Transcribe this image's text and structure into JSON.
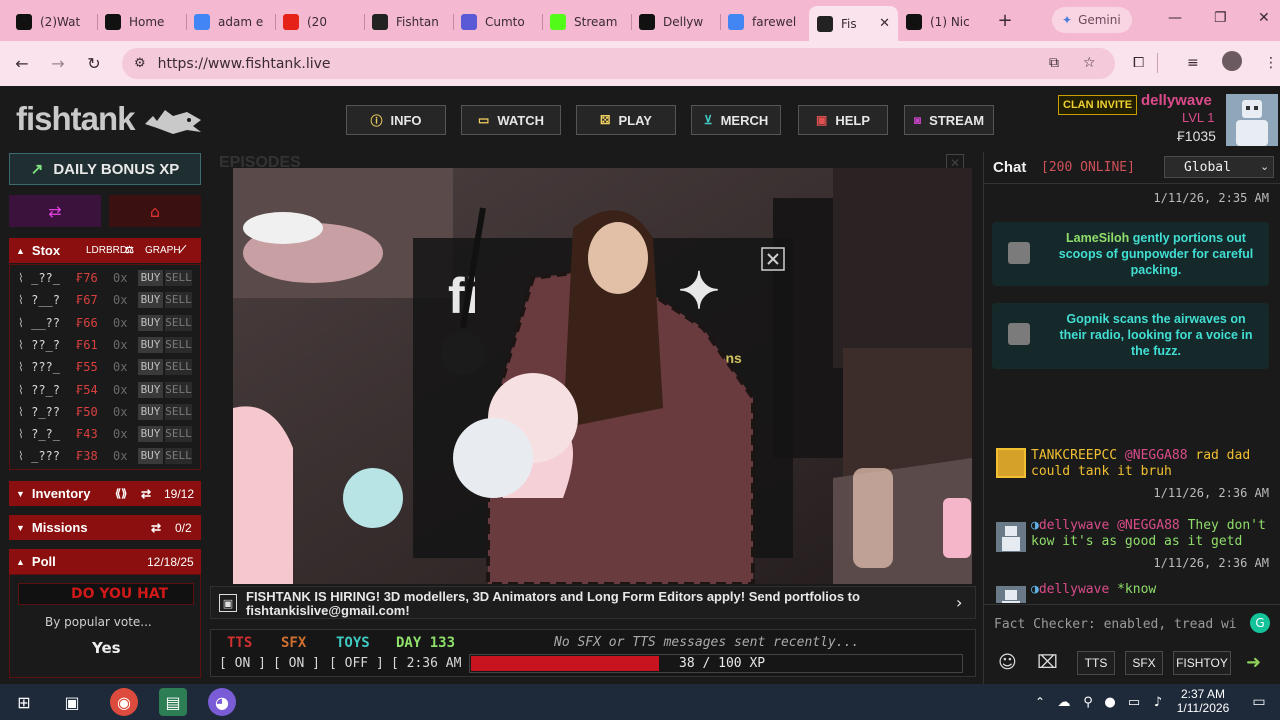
{
  "browser": {
    "tabs": [
      {
        "title": "(2)Wat",
        "icon": "tiktok-icon",
        "color": "#111111"
      },
      {
        "title": "Home",
        "icon": "x-icon",
        "color": "#111111"
      },
      {
        "title": "adam e",
        "icon": "google-icon",
        "color": "#4285f4"
      },
      {
        "title": "(20",
        "icon": "youtube-icon",
        "color": "#e62117"
      },
      {
        "title": "Fishtan",
        "icon": "fishtank-icon",
        "color": "#222222"
      },
      {
        "title": "Cumto",
        "icon": "headset-icon",
        "color": "#5a5ad6"
      },
      {
        "title": "Stream",
        "icon": "kick-icon",
        "color": "#53fc18"
      },
      {
        "title": "Dellyw",
        "icon": "tiktok-icon",
        "color": "#111111"
      },
      {
        "title": "farewel",
        "icon": "google-icon",
        "color": "#4285f4"
      },
      {
        "title": "Fis",
        "icon": "fishtank-icon",
        "color": "#222222"
      },
      {
        "title": "(1) Nic",
        "icon": "x-icon",
        "color": "#111111"
      }
    ],
    "active_tab_index": 9,
    "url": "https://www.fishtank.live",
    "gemini_label": "Gemini"
  },
  "site": {
    "logo": "fishtank",
    "nav": [
      {
        "label": "INFO",
        "icon": "info-icon",
        "color": "#f0d060"
      },
      {
        "label": "WATCH",
        "icon": "camera-icon",
        "color": "#f0d060"
      },
      {
        "label": "PLAY",
        "icon": "dice-icon",
        "color": "#f0d060"
      },
      {
        "label": "MERCH",
        "icon": "cart-icon",
        "color": "#3fc9c0"
      },
      {
        "label": "HELP",
        "icon": "help-icon",
        "color": "#e05050"
      },
      {
        "label": "STREAM",
        "icon": "stream-icon",
        "color": "#cc44cc"
      }
    ],
    "user": {
      "clan_invite": "CLAN INVITE",
      "name": "dellywave",
      "level": "LVL 1",
      "coins": "₣1035"
    }
  },
  "sidebar": {
    "daily_bonus": "DAILY BONUS XP",
    "stox": {
      "title": "Stox",
      "leaderboard": "LDRBRD",
      "graph": "GRAPH",
      "rows": [
        {
          "ticker": "_??_",
          "price": "₣76",
          "count": "0x"
        },
        {
          "ticker": "?__?",
          "price": "₣67",
          "count": "0x"
        },
        {
          "ticker": "__??",
          "price": "₣66",
          "count": "0x"
        },
        {
          "ticker": "??_?",
          "price": "₣61",
          "count": "0x"
        },
        {
          "ticker": "???_",
          "price": "₣55",
          "count": "0x"
        },
        {
          "ticker": "??_?",
          "price": "₣54",
          "count": "0x"
        },
        {
          "ticker": "?_??",
          "price": "₣50",
          "count": "0x"
        },
        {
          "ticker": "?_?_",
          "price": "₣43",
          "count": "0x"
        },
        {
          "ticker": "_???",
          "price": "₣38",
          "count": "0x"
        }
      ],
      "buy": "BUY",
      "sell": "SELL"
    },
    "inventory": {
      "title": "Inventory",
      "count": "19/12"
    },
    "missions": {
      "title": "Missions",
      "count": "0/2"
    },
    "poll": {
      "title": "Poll",
      "date": "12/18/25",
      "marquee": "DO YOU HAT",
      "by_vote": "By popular vote...",
      "answer": "Yes"
    }
  },
  "stream": {
    "episodes_label": "EPISODES",
    "hiring": "FISHTANK IS HIRING! 3D modellers, 3D Animators and Long Form Editors apply! Send portfolios to fishtankislive@gmail.com!",
    "tts": {
      "label": "TTS",
      "value": "[ ON ]"
    },
    "sfx": {
      "label": "SFX",
      "value": "[ ON ]"
    },
    "toys": {
      "label": "TOYS",
      "value": "[ OFF ]"
    },
    "day": {
      "label": "DAY 133",
      "time": "[ 2:36 AM ]"
    },
    "no_msg": "No SFX or TTS messages sent recently...",
    "xp": {
      "text": "38 / 100 XP",
      "progress": 0.38
    }
  },
  "chat": {
    "title": "Chat",
    "online": "[200 ONLINE]",
    "channel": "Global",
    "messages": [
      {
        "type": "emote",
        "name": "LameSiloh",
        "text": "gently portions out scoops of gunpowder for careful packing."
      },
      {
        "type": "emote",
        "name": "Gopnik",
        "text": "scans the airwaves on their radio, looking for a voice in the fuzz."
      },
      {
        "type": "msg",
        "name": "TANKCREEPCC",
        "mention": "@NEGGA88",
        "text": "rad dad could tank it bruh",
        "time": "1/11/26, 2:36 AM"
      },
      {
        "type": "msg",
        "name": "dellywave",
        "mention": "@NEGGA88",
        "text": "They don't kow it's as good as it getd",
        "time": "1/11/26, 2:36 AM"
      },
      {
        "type": "msg",
        "name": "dellywave",
        "mention": "",
        "text": "*know",
        "time": "1/11/26, 2:36 AM"
      }
    ],
    "top_time": "1/11/26, 2:35 AM",
    "input_placeholder": "Fact Checker: enabled, tread wi",
    "tools": [
      "TTS",
      "SFX",
      "FISHTOY"
    ]
  },
  "taskbar": {
    "time": "2:37 AM",
    "date": "1/11/2026"
  }
}
